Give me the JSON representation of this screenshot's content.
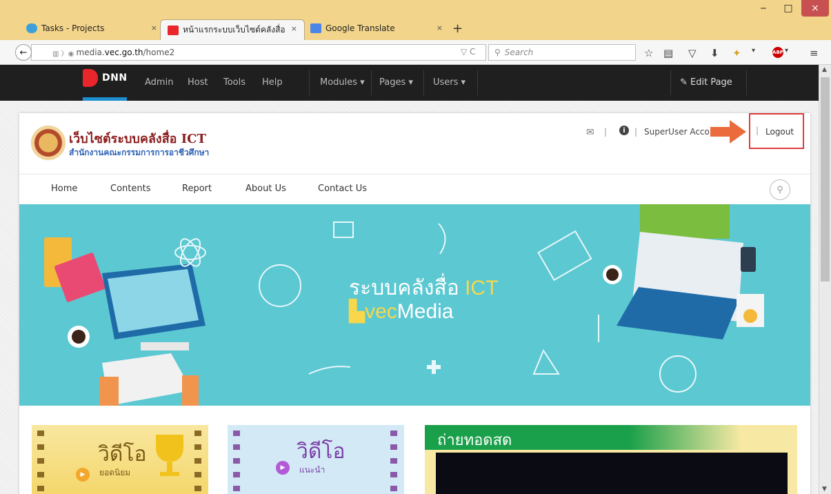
{
  "window": {
    "tabs": [
      {
        "label": "Tasks - Projects",
        "close": "×",
        "icon_color": "#3f9fd8",
        "icon": "tasks-icon"
      },
      {
        "label": "หน้าแรกระบบเว็บไซต์คลังสื่อ",
        "close": "×",
        "icon_color": "#e8262c",
        "icon": "dnn-icon"
      },
      {
        "label": "Google Translate",
        "close": "×",
        "icon_color": "#4a86e8",
        "icon": "translate-icon"
      }
    ],
    "new_tab": "+",
    "minimize": "‒",
    "maximize": "□",
    "close": "×"
  },
  "navbar": {
    "back": "←",
    "url_prefix": "media.",
    "url_domain": "vec.go.th",
    "url_path": "/home2",
    "url_controls": "▽ C",
    "search_placeholder": "Search",
    "toolbar_icons": [
      "star-icon",
      "reading-list-icon",
      "pocket-icon",
      "download-icon",
      "extension-icon",
      "adblock-icon",
      "menu-icon"
    ],
    "abp": "ABP",
    "menu": "≡"
  },
  "dnn": {
    "logo_text": "DNN",
    "menu": [
      "Admin",
      "Host",
      "Tools",
      "Help",
      "Modules ▾",
      "Pages ▾",
      "Users ▾"
    ],
    "edit_page": "Edit Page"
  },
  "site": {
    "title": "เว็บไซต์ระบบคลังสื่อ ICT",
    "subtitle": "สำนักงานคณะกรรมการการอาชีวศึกษา",
    "user": "SuperUser Acco",
    "logout": "Logout",
    "separator": "|",
    "nav": [
      "Home",
      "Contents",
      "Report",
      "About Us",
      "Contact Us"
    ]
  },
  "banner": {
    "title_prefix": "ระบบคลังสื่อ ",
    "title_ict": "ICT",
    "sub_prefix": "▙",
    "sub_vec": "vec",
    "sub_rest": "Media",
    "bg_color": "#5cc8d2"
  },
  "cards": {
    "card1_title": "วิดีโอ",
    "card1_sub": "ยอดนิยม",
    "card2_title": "วิดีโอ",
    "card2_sub": "แนะนำ",
    "live_title": "ถ่ายทอดสด"
  }
}
